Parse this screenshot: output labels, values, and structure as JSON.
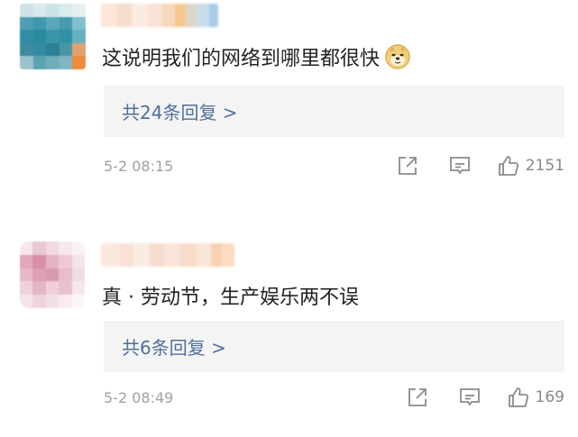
{
  "comments": [
    {
      "text": "这说明我们的网络到哪里都很快",
      "emoji": "doge-emoji",
      "replies_label": "共24条回复 >",
      "time": "5-2 08:15",
      "likes": "2151",
      "icons": [
        "share-icon",
        "comment-icon",
        "like-icon"
      ]
    },
    {
      "text": "真 · 劳动节，生产娱乐两不误",
      "replies_label": "共6条回复 >",
      "time": "5-2 08:49",
      "likes": "169",
      "icons": [
        "share-icon",
        "comment-icon",
        "like-icon"
      ]
    }
  ],
  "colors": {
    "reply_link": "#50709a",
    "meta_text": "#a0a0a0",
    "reply_box_bg": "#f4f4f4",
    "body_text": "#222222"
  }
}
